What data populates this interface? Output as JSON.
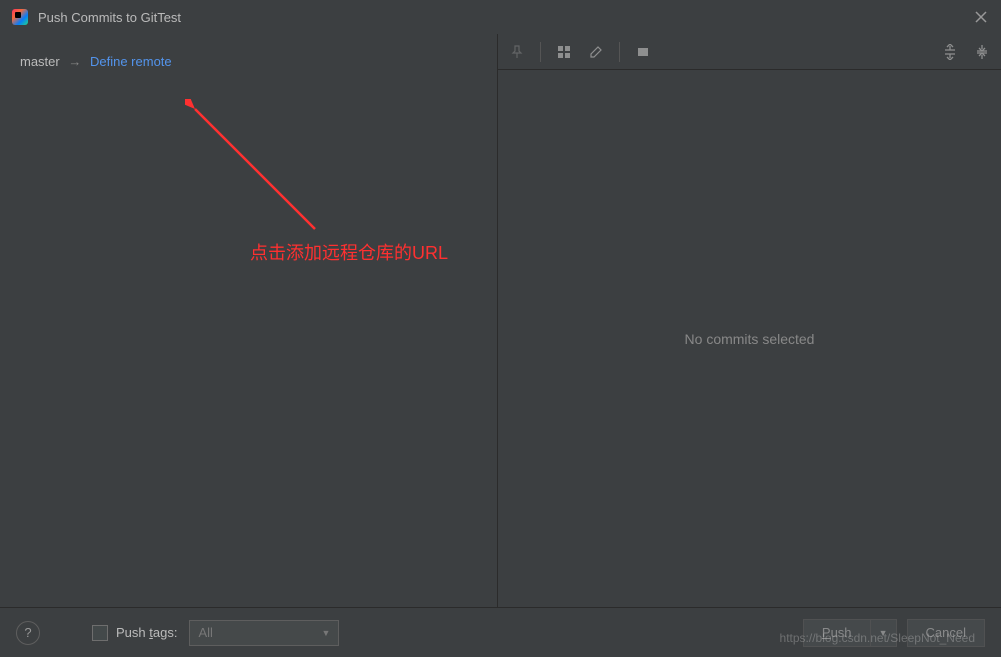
{
  "window": {
    "title": "Push Commits to GitTest"
  },
  "branch": {
    "local": "master",
    "define_remote_label": "Define remote"
  },
  "annotation": {
    "text": "点击添加远程仓库的URL"
  },
  "right": {
    "empty_text": "No commits selected"
  },
  "footer": {
    "help": "?",
    "push_tags_label_prefix": "Push ",
    "push_tags_label_underlined": "t",
    "push_tags_label_suffix": "ags:",
    "dropdown_value": "All",
    "push_btn_prefix": "",
    "push_btn_underlined": "P",
    "push_btn_suffix": "ush",
    "cancel_label": "Cancel"
  },
  "watermark": "https://blog.csdn.net/SleepNot_Need",
  "icons": {
    "pin": "pin-icon",
    "grid": "grid-icon",
    "edit": "edit-icon",
    "rect": "rect-icon",
    "expand": "expand-icon",
    "collapse": "collapse-icon"
  }
}
